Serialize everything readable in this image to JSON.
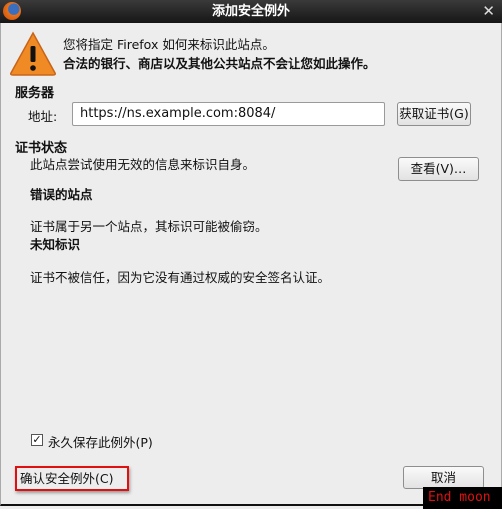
{
  "window": {
    "title": "添加安全例外"
  },
  "intro": {
    "line1": "您将指定 Firefox 如何来标识此站点。",
    "line2": "合法的银行、商店以及其他公共站点不会让您如此操作。"
  },
  "server": {
    "heading": "服务器",
    "address_label": "地址:",
    "address_value": "https://ns.example.com:8084/",
    "get_cert_button": "获取证书(G)"
  },
  "cert_status": {
    "heading": "证书状态",
    "summary": "此站点尝试使用无效的信息来标识自身。",
    "view_button": "查看(V)…",
    "issues": [
      {
        "title": "错误的站点",
        "desc": "证书属于另一个站点，其标识可能被偷窃。"
      },
      {
        "title": "未知标识",
        "desc": "证书不被信任，因为它没有通过权威的安全签名认证。"
      }
    ]
  },
  "permanent": {
    "label": "永久保存此例外(P)",
    "checked": true
  },
  "buttons": {
    "confirm": "确认安全例外(C)",
    "cancel": "取消"
  },
  "watermark": "End moon",
  "colors": {
    "highlight": "#e01010",
    "warning": "#f08a24"
  }
}
